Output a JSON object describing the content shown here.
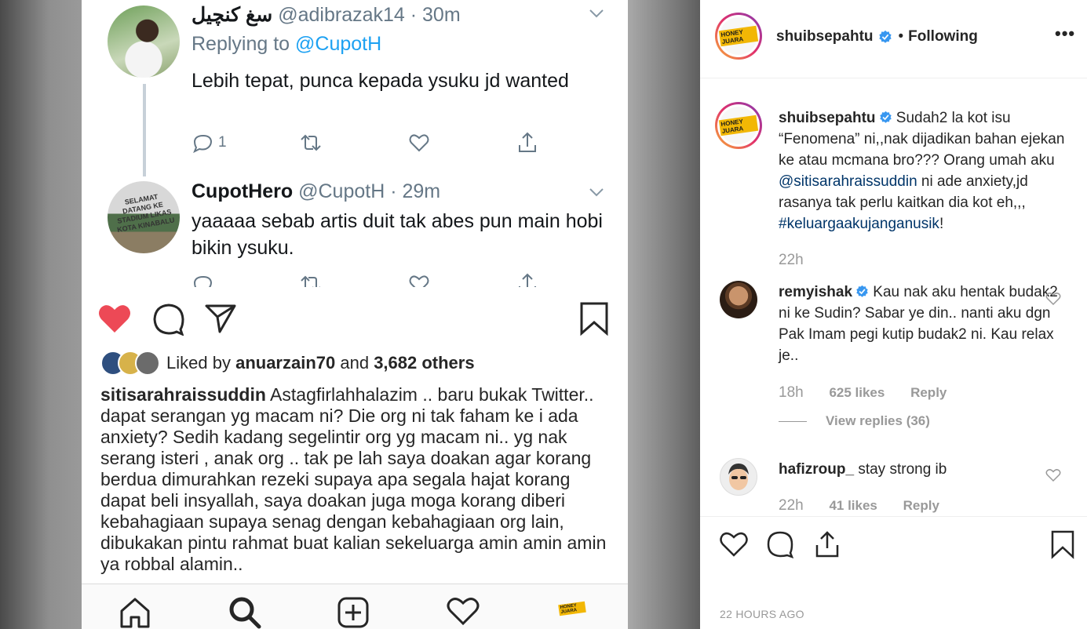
{
  "tweets": [
    {
      "display_name": "سغ كنچيل",
      "handle": "@adibrazak14 · 30m",
      "replying_label": "Replying to ",
      "replying_to": "@CupotH",
      "text": "Lebih tepat, punca kepada ysuku jd wanted",
      "reply_count": "1"
    },
    {
      "display_name": "CupotHero",
      "handle": "@CupotH · 29m",
      "avatar_sign": "SELAMAT DATANG KE STADIUM LIKAS KOTA KINABALU",
      "text": "yaaaaa sebab artis duit tak abes pun main hobi bikin ysuku."
    }
  ],
  "post": {
    "liked_by_label": "Liked by ",
    "liked_by_user": "anuarzain70",
    "and_label": " and ",
    "others_count": "3,682 others",
    "caption_user": "sitisarahraissuddin",
    "caption_text": " Astagfirlahhalazim .. baru bukak Twitter.. dapat serangan yg macam ni? Die org ni tak faham ke i ada anxiety?  Sedih kadang segelintir org yg macam ni.. yg nak serang isteri , anak org .. tak pe lah saya doakan agar korang berdua dimurahkan rezeki supaya apa segala hajat korang dapat beli insyallah, saya doakan juga moga korang diberi kebahagiaan supaya  senag dengan kebahagiaan org lain, dibukakan pintu rahmat buat kalian sekeluarga amin amin amin ya robbal alamin.."
  },
  "panel": {
    "username": "shuibsepahtu",
    "separator": "•",
    "following": "Following",
    "more": "•••",
    "logo_text": "HONEY JUARA",
    "caption": {
      "user": "shuibsepahtu",
      "text_1": " Sudah2 la kot isu “Fenomena” ni,,nak dijadikan bahan ejekan ke atau mcmana bro??? Orang umah aku ",
      "mention": "@sitisarahraissuddin",
      "text_2": " ni ade anxiety,jd rasanya tak perlu kaitkan dia kot eh,,, ",
      "hashtag": "#keluargaakujanganusik",
      "text_3": "!",
      "time": "22h"
    },
    "comments": [
      {
        "user": "remyishak",
        "text": " Kau nak aku hentak budak2 ni ke Sudin? Sabar ye din.. nanti aku dgn Pak Imam pegi kutip budak2 ni. Kau relax je..",
        "time": "18h",
        "likes": "625 likes",
        "reply": "Reply",
        "view_replies": "View replies (36)"
      },
      {
        "user": "hafizroup_",
        "text": " stay strong ib",
        "time": "22h",
        "likes": "41 likes",
        "reply": "Reply"
      }
    ],
    "timestamp": "22 HOURS AGO"
  },
  "colors": {
    "like_red": "#ed4956",
    "twitter_blue": "#1da1f2",
    "verified_blue": "#3897f0",
    "link_navy": "#003569"
  }
}
